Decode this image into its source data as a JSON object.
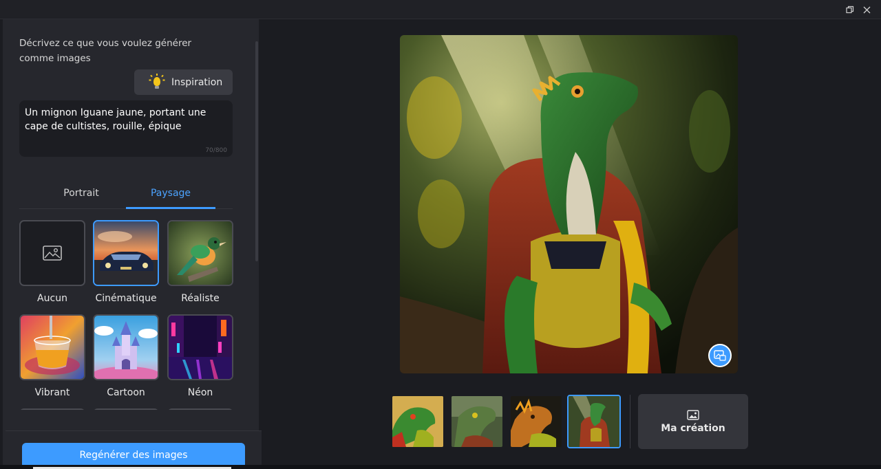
{
  "window": {
    "restore_icon": "restore-icon",
    "close_icon": "close-icon"
  },
  "sidebar": {
    "prompt_label": "Décrivez ce que vous voulez générer comme images",
    "inspiration_label": "Inspiration",
    "inspiration_icon": "lightbulb-icon",
    "prompt_text": "Un mignon Iguane jaune, portant une cape de cultistes, rouille, épique",
    "char_count": "70/800",
    "tabs": [
      {
        "label": "Portrait",
        "active": false
      },
      {
        "label": "Paysage",
        "active": true
      }
    ],
    "styles": [
      {
        "label": "Aucun",
        "selected": false
      },
      {
        "label": "Cinématique",
        "selected": true
      },
      {
        "label": "Réaliste",
        "selected": false
      },
      {
        "label": "Vibrant",
        "selected": false
      },
      {
        "label": "Cartoon",
        "selected": false
      },
      {
        "label": "Néon",
        "selected": false
      }
    ],
    "regenerate_label": "Regénérer des images"
  },
  "main": {
    "thumbnails_count": 4,
    "selected_thumbnail": 4,
    "creation_label": "Ma création",
    "creation_icon": "image-icon",
    "save_icon": "image-save-icon"
  },
  "colors": {
    "accent": "#3d9bff",
    "background": "#1b1c21",
    "sidebar": "#26272d"
  }
}
